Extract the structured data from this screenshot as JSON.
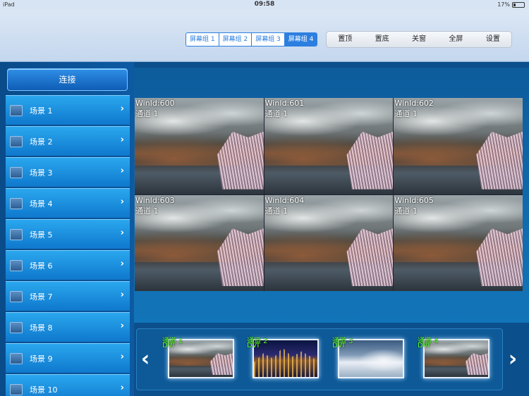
{
  "status_bar": {
    "device": "iPad",
    "time": "09:58",
    "battery": "17%"
  },
  "screen_groups": {
    "items": [
      "屏幕组 1",
      "屏幕组 2",
      "屏幕组 3",
      "屏幕组 4"
    ],
    "selected": "屏幕组 4"
  },
  "actions": [
    "置顶",
    "置底",
    "关窗",
    "全屏",
    "设置"
  ],
  "sidebar": {
    "connect_label": "连接",
    "scenes": [
      "场景 1",
      "场景 2",
      "场景 3",
      "场景 4",
      "场景 5",
      "场景 6",
      "场景 7",
      "场景 8",
      "场景 9",
      "场景 10"
    ]
  },
  "windows": [
    {
      "id": "WinId:600",
      "channel": "通道 1"
    },
    {
      "id": "WinId:601",
      "channel": "通道 1"
    },
    {
      "id": "WinId:602",
      "channel": "通道 1"
    },
    {
      "id": "WinId:603",
      "channel": "通道 1"
    },
    {
      "id": "WinId:604",
      "channel": "通道 1"
    },
    {
      "id": "WinId:605",
      "channel": "通道 1"
    }
  ],
  "channels": [
    {
      "name": "通道 1",
      "type": "DVI"
    },
    {
      "name": "通道 2",
      "type": "DVI"
    },
    {
      "name": "通道 3",
      "type": "DVI"
    },
    {
      "name": "通道 4",
      "type": "DVI"
    }
  ],
  "nav": {
    "prev": "‹",
    "next": "›"
  }
}
